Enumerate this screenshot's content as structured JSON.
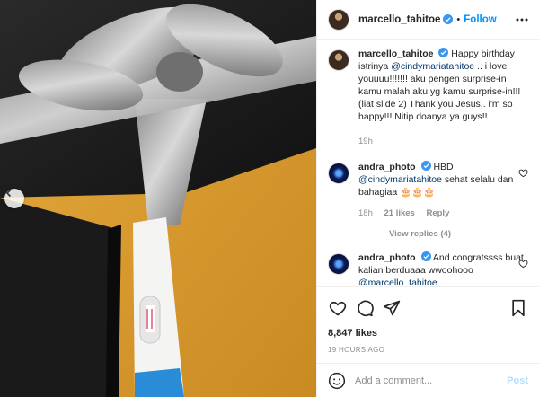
{
  "post": {
    "username": "marcello_tahitoe",
    "follow_label": "Follow",
    "dot": "•"
  },
  "caption": {
    "username": "marcello_tahitoe",
    "text_before": "Happy birthday istrinya ",
    "mention": "@cindymariatahitoe",
    "text_after": " .. i love youuuu!!!!!!! aku pengen surprise-in kamu malah aku yg kamu surprise-in!!! (liat slide 2) Thank you Jesus.. i'm so happy!!! Nitip doanya ya guys!!",
    "time": "19h"
  },
  "comments": [
    {
      "username": "andra_photo",
      "text_before": "HBD ",
      "mention": "@cindymariatahitoe",
      "text_after": " sehat selalu dan bahagiaa 🎂🎂🎂",
      "time": "18h",
      "likes": "21 likes",
      "reply_label": "Reply",
      "view_replies": "View replies (4)"
    },
    {
      "username": "andra_photo",
      "text_before": "And congratssss buat kalian berduaaa wwoohooo ",
      "mention": "@marcello_tahitoe"
    }
  ],
  "stats": {
    "likes": "8,847 likes",
    "posted_ago": "19 HOURS AGO"
  },
  "add_comment": {
    "placeholder": "Add a comment...",
    "post_label": "Post"
  },
  "colors": {
    "accent": "#0095f6",
    "verified": "#3897f0",
    "mention": "#00376b",
    "muted": "#8e8e8e"
  },
  "icons": [
    "slide-arrow-icon",
    "verified-badge-icon",
    "more-options-icon",
    "heart-icon",
    "comment-icon",
    "share-icon",
    "bookmark-icon",
    "emoji-icon"
  ]
}
